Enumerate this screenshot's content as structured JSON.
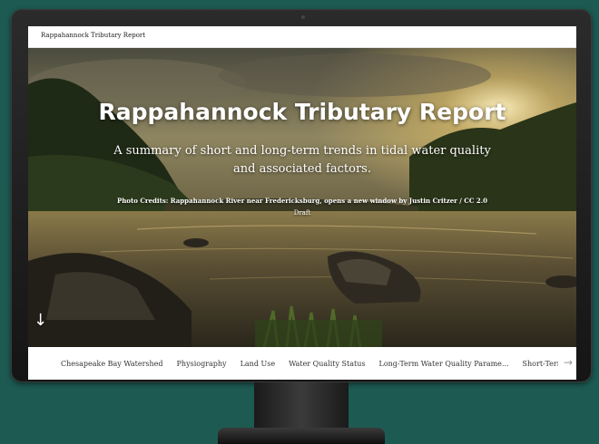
{
  "app": {
    "title": "Rappahannock Tributary Report"
  },
  "hero": {
    "title": "Rappahannock Tributary Report",
    "subtitle": "A summary of short and long-term trends in tidal water quality and associated factors.",
    "credits": "Photo Credits: Rappahannock River near Fredericksburg, opens a new window by Justin Critzer / CC 2.0",
    "status": "Draft"
  },
  "nav": {
    "items": [
      "Chesapeake Bay Watershed",
      "Physiography",
      "Land Use",
      "Water Quality Status",
      "Long-Term Water Quality Parame...",
      "Short-Term Water Q"
    ]
  },
  "icons": {
    "scroll": "arrow-down-icon",
    "next": "arrow-right-icon"
  },
  "colors": {
    "background": "#1d5a52",
    "bezel": "#1f1f1f"
  }
}
